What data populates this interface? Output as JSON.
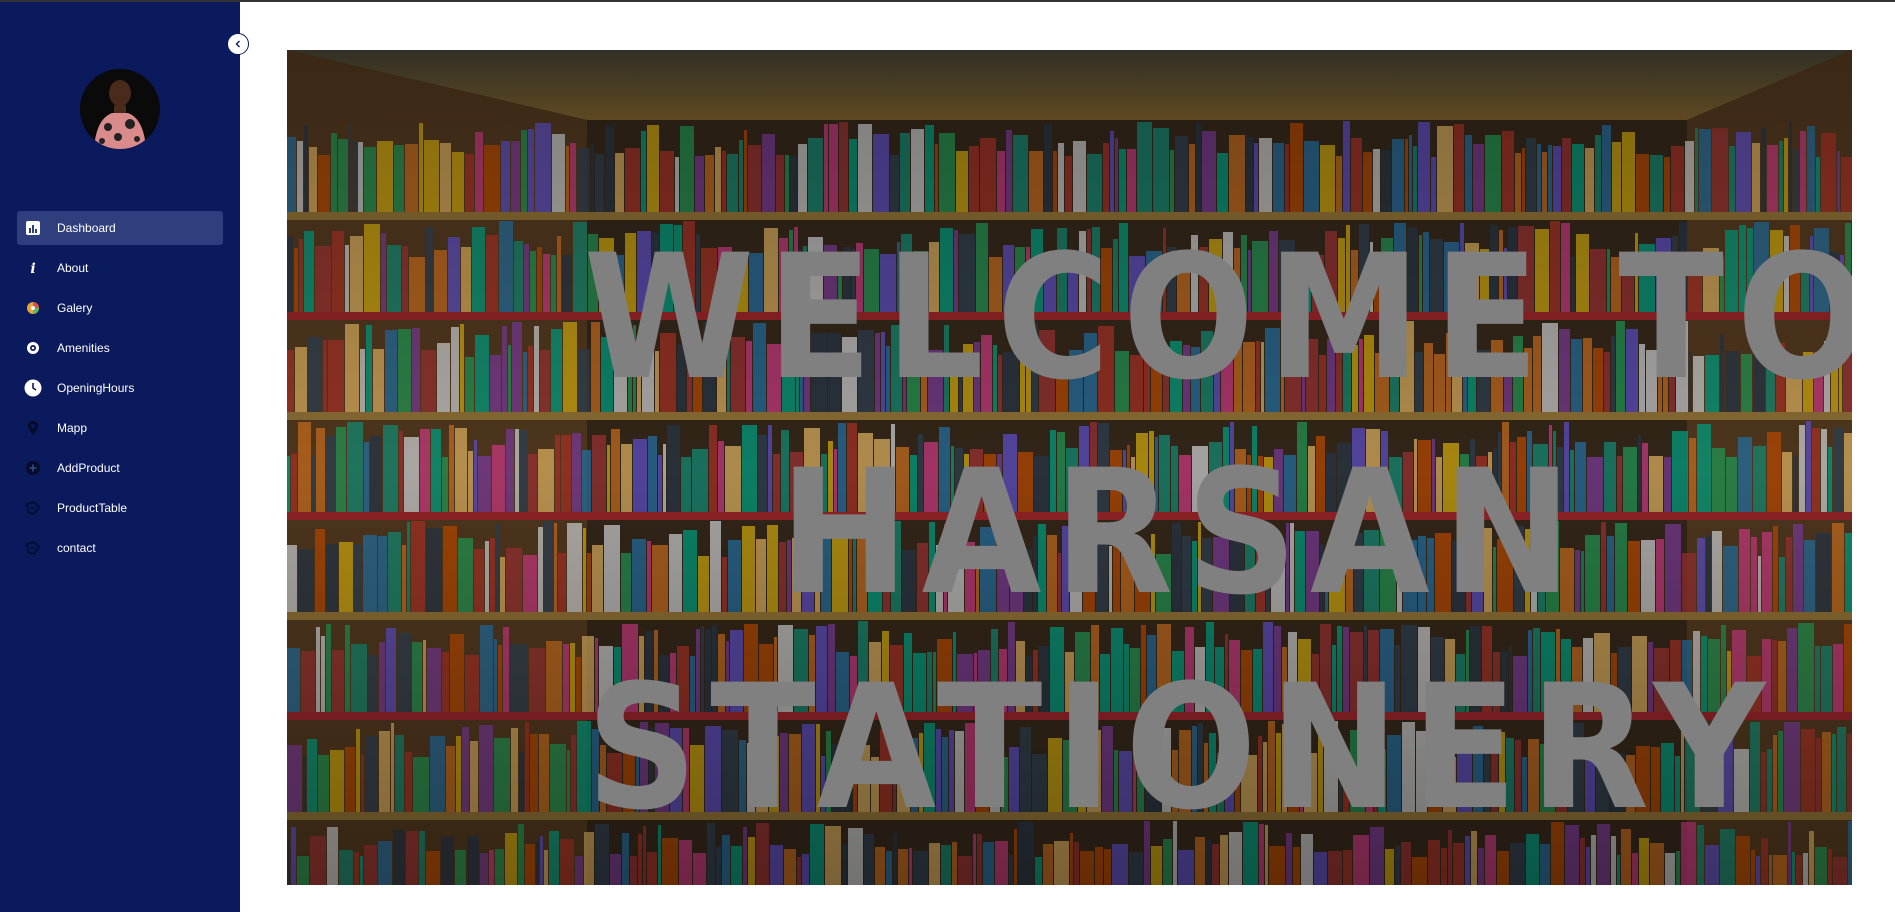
{
  "topbar": {},
  "sidebar": {
    "avatar_icon": "user-avatar",
    "collapse_icon": "chevron-left-icon",
    "items": [
      {
        "label": "Dashboard",
        "icon": "dashboard-icon",
        "active": true
      },
      {
        "label": "About",
        "icon": "info-icon"
      },
      {
        "label": "Galery",
        "icon": "palette-icon"
      },
      {
        "label": "Amenities",
        "icon": "target-icon"
      },
      {
        "label": "OpeningHours",
        "icon": "clock-icon"
      },
      {
        "label": "Mapp",
        "icon": "map-pin-icon"
      },
      {
        "label": "AddProduct",
        "icon": "add-circle-icon"
      },
      {
        "label": "ProductTable",
        "icon": "table-icon"
      },
      {
        "label": "contact",
        "icon": "contact-icon"
      }
    ]
  },
  "hero": {
    "lines": [
      "WELCOME TO",
      "HARSAN",
      "STATIONERY"
    ],
    "text_color": "#808080"
  },
  "colors": {
    "sidebar_bg": "#0b1a5c",
    "active_item_bg": "#2f3f7e"
  }
}
